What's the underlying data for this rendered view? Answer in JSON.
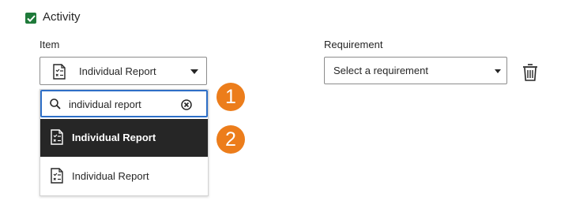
{
  "activity": {
    "label": "Activity",
    "checked": true,
    "checkbox_color": "#1f7a3a"
  },
  "item_field": {
    "label": "Item",
    "selected_value": "Individual Report",
    "icon": "document-checklist-icon"
  },
  "requirement_field": {
    "label": "Requirement",
    "placeholder": "Select a requirement"
  },
  "delete_icon": "trash-icon",
  "dropdown": {
    "search_value": "individual report",
    "options": [
      {
        "label": "Individual Report",
        "icon": "document-checklist-icon",
        "highlighted": true
      },
      {
        "label": "Individual Report",
        "icon": "document-checklist-icon",
        "highlighted": false
      }
    ]
  },
  "callouts": [
    "1",
    "2"
  ],
  "colors": {
    "focus_border": "#2e6fc7",
    "highlight_bg": "#262626",
    "callout_bg": "#ec7d1b"
  }
}
